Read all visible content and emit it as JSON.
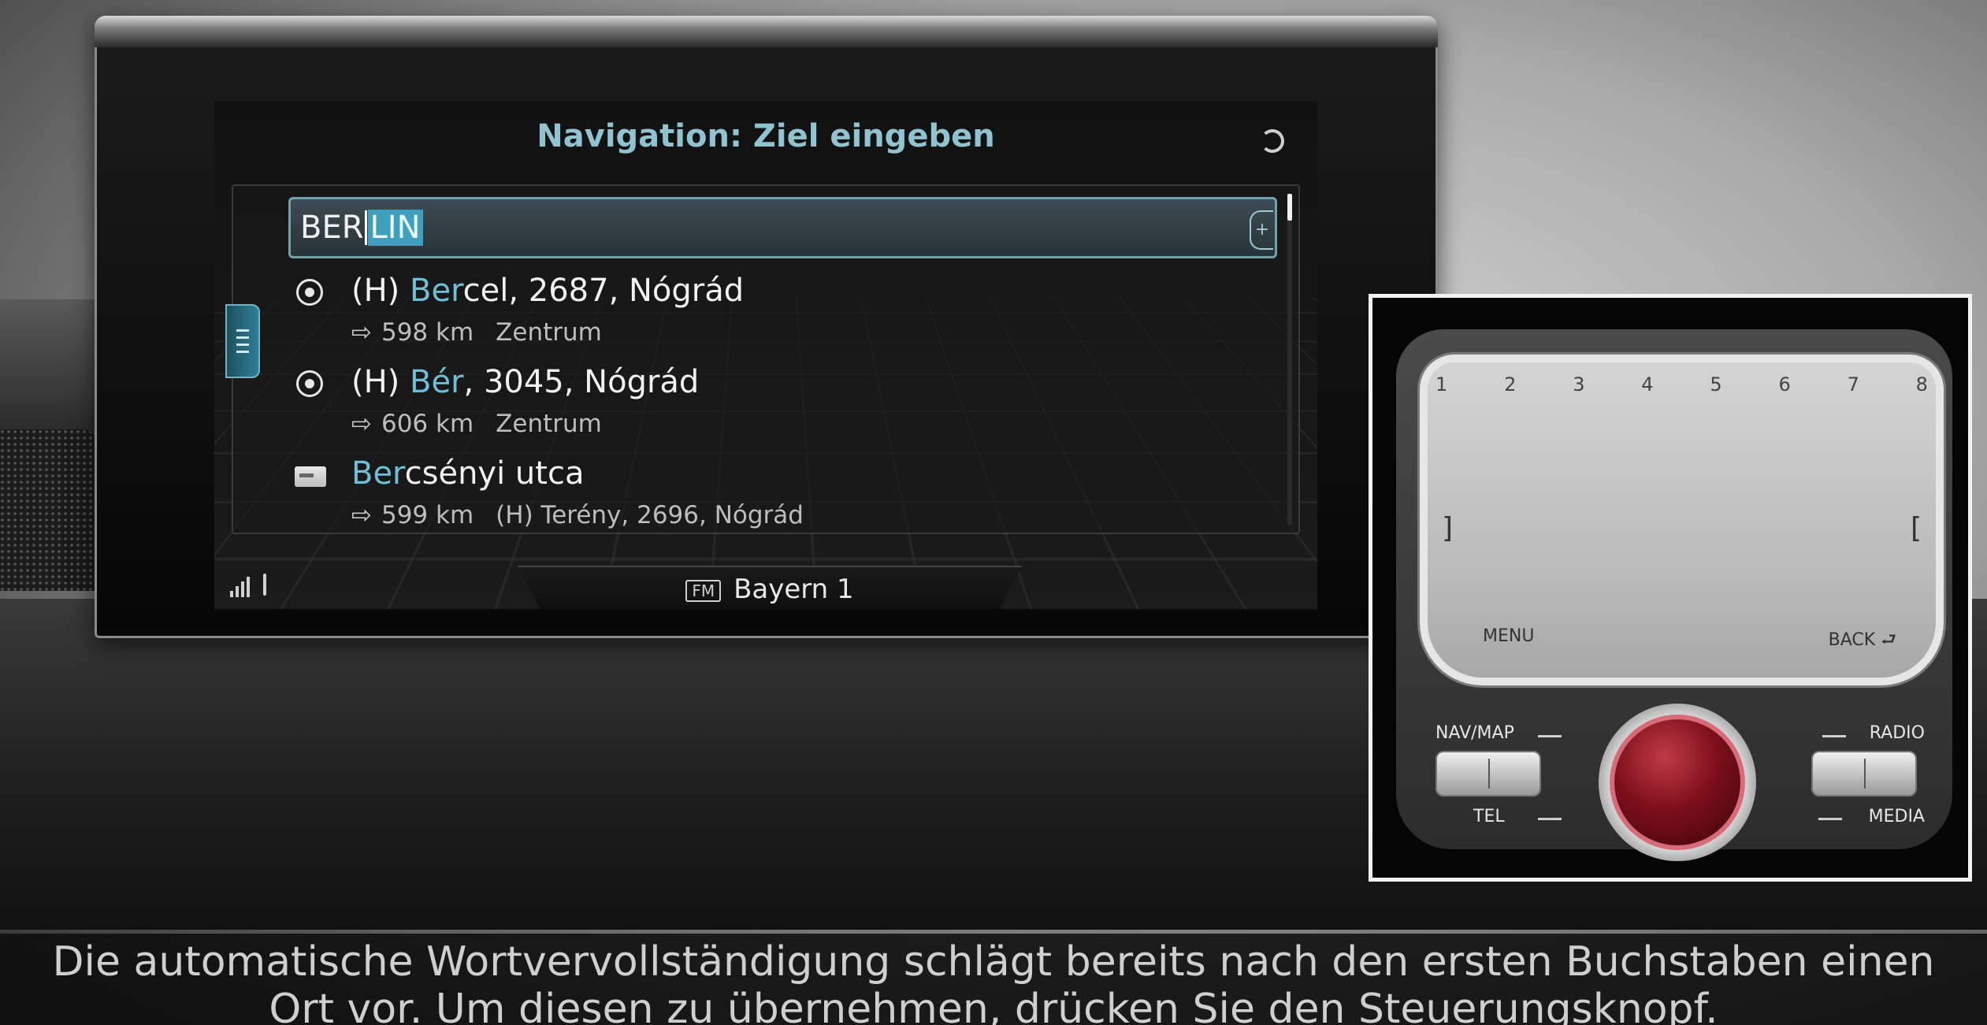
{
  "screen": {
    "title": "Navigation: Ziel eingeben"
  },
  "input": {
    "typed": "BER",
    "completion": "LIN",
    "plus_label": "+"
  },
  "results": [
    {
      "icon": "target-icon",
      "prefix": "(H) ",
      "match": "Ber",
      "rest": "cel, 2687, Nógrád",
      "distance": "598 km",
      "detail": "Zentrum"
    },
    {
      "icon": "target-icon",
      "prefix": "(H) ",
      "match": "Bér",
      "rest": ", 3045, Nógrád",
      "distance": "606 km",
      "detail": "Zentrum"
    },
    {
      "icon": "street-sign-icon",
      "prefix": "",
      "match": "Ber",
      "rest": "csényi utca",
      "distance": "599 km",
      "detail": "(H) Terény, 2696, Nógrád"
    }
  ],
  "status": {
    "band": "FM",
    "station": "Bayern 1"
  },
  "controller": {
    "numbers": [
      "1",
      "2",
      "3",
      "4",
      "5",
      "6",
      "7",
      "8"
    ],
    "left_bracket": "]",
    "right_bracket": "[",
    "menu_label": "MENU",
    "back_label": "BACK",
    "back_arrow": "⮐",
    "nav_map_label": "NAV/MAP",
    "radio_label": "RADIO",
    "tel_label": "TEL",
    "media_label": "MEDIA"
  },
  "subtitle": {
    "line1": "Die automatische Wortvervollständigung schlägt bereits nach den ersten Buchstaben einen",
    "line2": "Ort vor. Um diesen zu übernehmen, drücken Sie den Steuerungsknopf."
  },
  "colors": {
    "accent": "#6fc0d6",
    "title": "#8fc3cf",
    "knob": "#7d0f1b"
  }
}
